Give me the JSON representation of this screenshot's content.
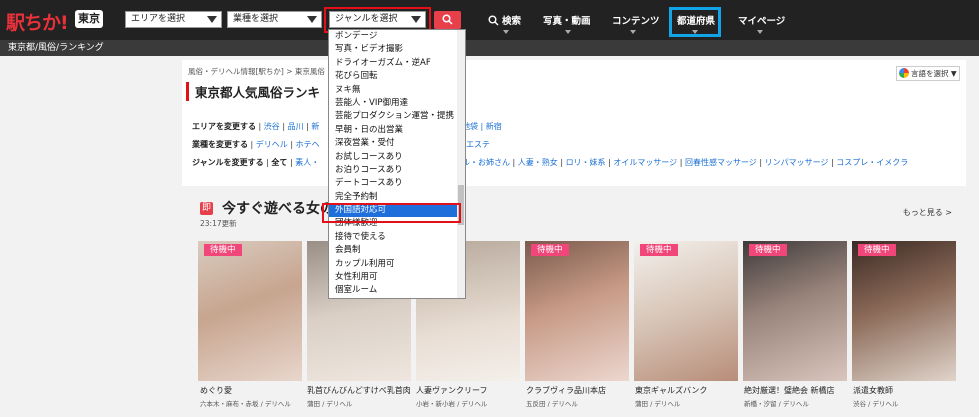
{
  "header": {
    "logo": "駅ちか!",
    "region_badge": "東京",
    "area_select": "エリアを選択",
    "industry_select": "業種を選択",
    "genre_select": "ジャンルを選択",
    "nav": [
      "検索",
      "写真・動画",
      "コンテンツ",
      "都道府県",
      "マイページ"
    ]
  },
  "breadcrumb_bar": "東京都/風俗/ランキング",
  "page": {
    "small_crumb": "風俗・デリヘル情報[駅ちか]   >   東京風俗",
    "title": "東京都人気風俗ランキ",
    "translate": "言語を選択 ▼",
    "filters": {
      "area_label": "エリアを変更する",
      "area_links": [
        "渋谷",
        "品川",
        "新"
      ],
      "area_tail": "池袋 | 新宿",
      "industry_label": "業種を変更する",
      "industry_links": [
        "デリヘル",
        "ホテヘ"
      ],
      "industry_tail": "エステ",
      "genre_label": "ジャンルを変更する",
      "genre_all": "全て",
      "genre_links": [
        "素人・",
        "ル・お姉さん",
        "人妻・熟女",
        "ロリ・妹系",
        "オイルマッサージ",
        "回春性感マッサージ",
        "リンパマッサージ",
        "コスプレ・イメクラ"
      ]
    }
  },
  "section": {
    "icon": "即",
    "title": "今すぐ遊べる女の",
    "updated": "23:17更新",
    "more": "もっと見る >",
    "cards": [
      {
        "badge": "待機中",
        "name": "めぐり愛",
        "sub": "六本木・麻布・赤坂 / デリヘル"
      },
      {
        "badge": "待機中",
        "name": "乳首びんびんどすけべ乳首肉...",
        "sub": "蒲田 / デリヘル"
      },
      {
        "badge": "待機中",
        "name": "人妻ヴァンクリーフ",
        "sub": "小岩・新小岩 / デリヘル"
      },
      {
        "badge": "待機中",
        "name": "クラブヴィラ品川本店",
        "sub": "五反田 / デリヘル"
      },
      {
        "badge": "待機中",
        "name": "東京ギャルズバンク",
        "sub": "蒲田 / デリヘル"
      },
      {
        "badge": "待機中",
        "name": "絶対厳選！璧絶会 新橋店",
        "sub": "新橋・汐留 / デリヘル"
      },
      {
        "badge": "待機中",
        "name": "派遣女教師",
        "sub": "渋谷 / デリヘル"
      }
    ]
  },
  "dropdown": {
    "items": [
      "ボンデージ",
      "写真・ビデオ撮影",
      "ドライオーガズム・逆AF",
      "花びら回転",
      "ヌキ無",
      "芸能人・VIP御用達",
      "芸能プロダクション運営・提携",
      "早朝・日の出営業",
      "深夜営業・受付",
      "お試しコースあり",
      "お泊りコースあり",
      "デートコースあり",
      "完全予約制",
      "外国語対応可",
      "団体様歓迎",
      "接待で使える",
      "会員制",
      "カップル利用可",
      "女性利用可",
      "個室ルーム"
    ],
    "selected_index": 13
  },
  "colors": {
    "accent_red": "#e3101a",
    "highlight_blue": "#11a4e6",
    "select_blue": "#1e6fdc",
    "badge_pink": "#f0467a"
  }
}
